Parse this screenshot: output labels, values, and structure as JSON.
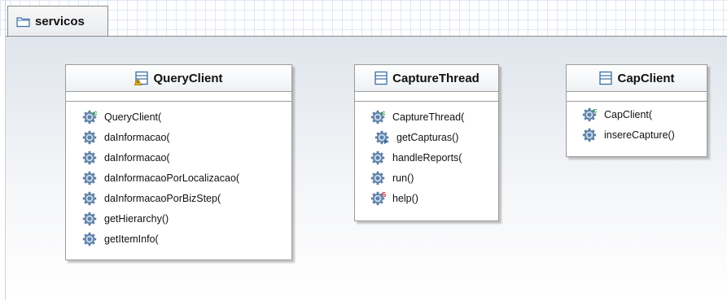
{
  "package": {
    "tab_label": "servicos",
    "icon": "folder-icon"
  },
  "classes": [
    {
      "name": "QueryClient",
      "icon": "class-warning-icon",
      "methods": [
        {
          "label": "QueryClient(",
          "icon": "constructor-gear-icon"
        },
        {
          "label": "daInformacao(",
          "icon": "gear-icon"
        },
        {
          "label": "daInformacao(",
          "icon": "gear-icon"
        },
        {
          "label": "daInformacaoPorLocalizacao(",
          "icon": "gear-icon"
        },
        {
          "label": "daInformacaoPorBizStep(",
          "icon": "gear-icon"
        },
        {
          "label": "getHierarchy()",
          "icon": "gear-icon"
        },
        {
          "label": "getItemInfo(",
          "icon": "gear-icon"
        }
      ]
    },
    {
      "name": "CaptureThread",
      "icon": "class-icon",
      "methods": [
        {
          "label": "CaptureThread(",
          "icon": "constructor-gear-icon"
        },
        {
          "label": "getCapturas()",
          "icon": "override-gear-icon"
        },
        {
          "label": "handleReports(",
          "icon": "gear-icon"
        },
        {
          "label": "run()",
          "icon": "gear-icon"
        },
        {
          "label": "help()",
          "icon": "static-gear-icon"
        }
      ]
    },
    {
      "name": "CapClient",
      "icon": "class-icon",
      "methods": [
        {
          "label": "CapClient(",
          "icon": "constructor-gear-icon"
        },
        {
          "label": "insereCapture()",
          "icon": "gear-icon"
        }
      ]
    }
  ],
  "colors": {
    "gear": "#5b7fa6",
    "constructor_badge": "#2e9a2e",
    "static_badge": "#d12b2b",
    "warning": "#e8b21a"
  }
}
